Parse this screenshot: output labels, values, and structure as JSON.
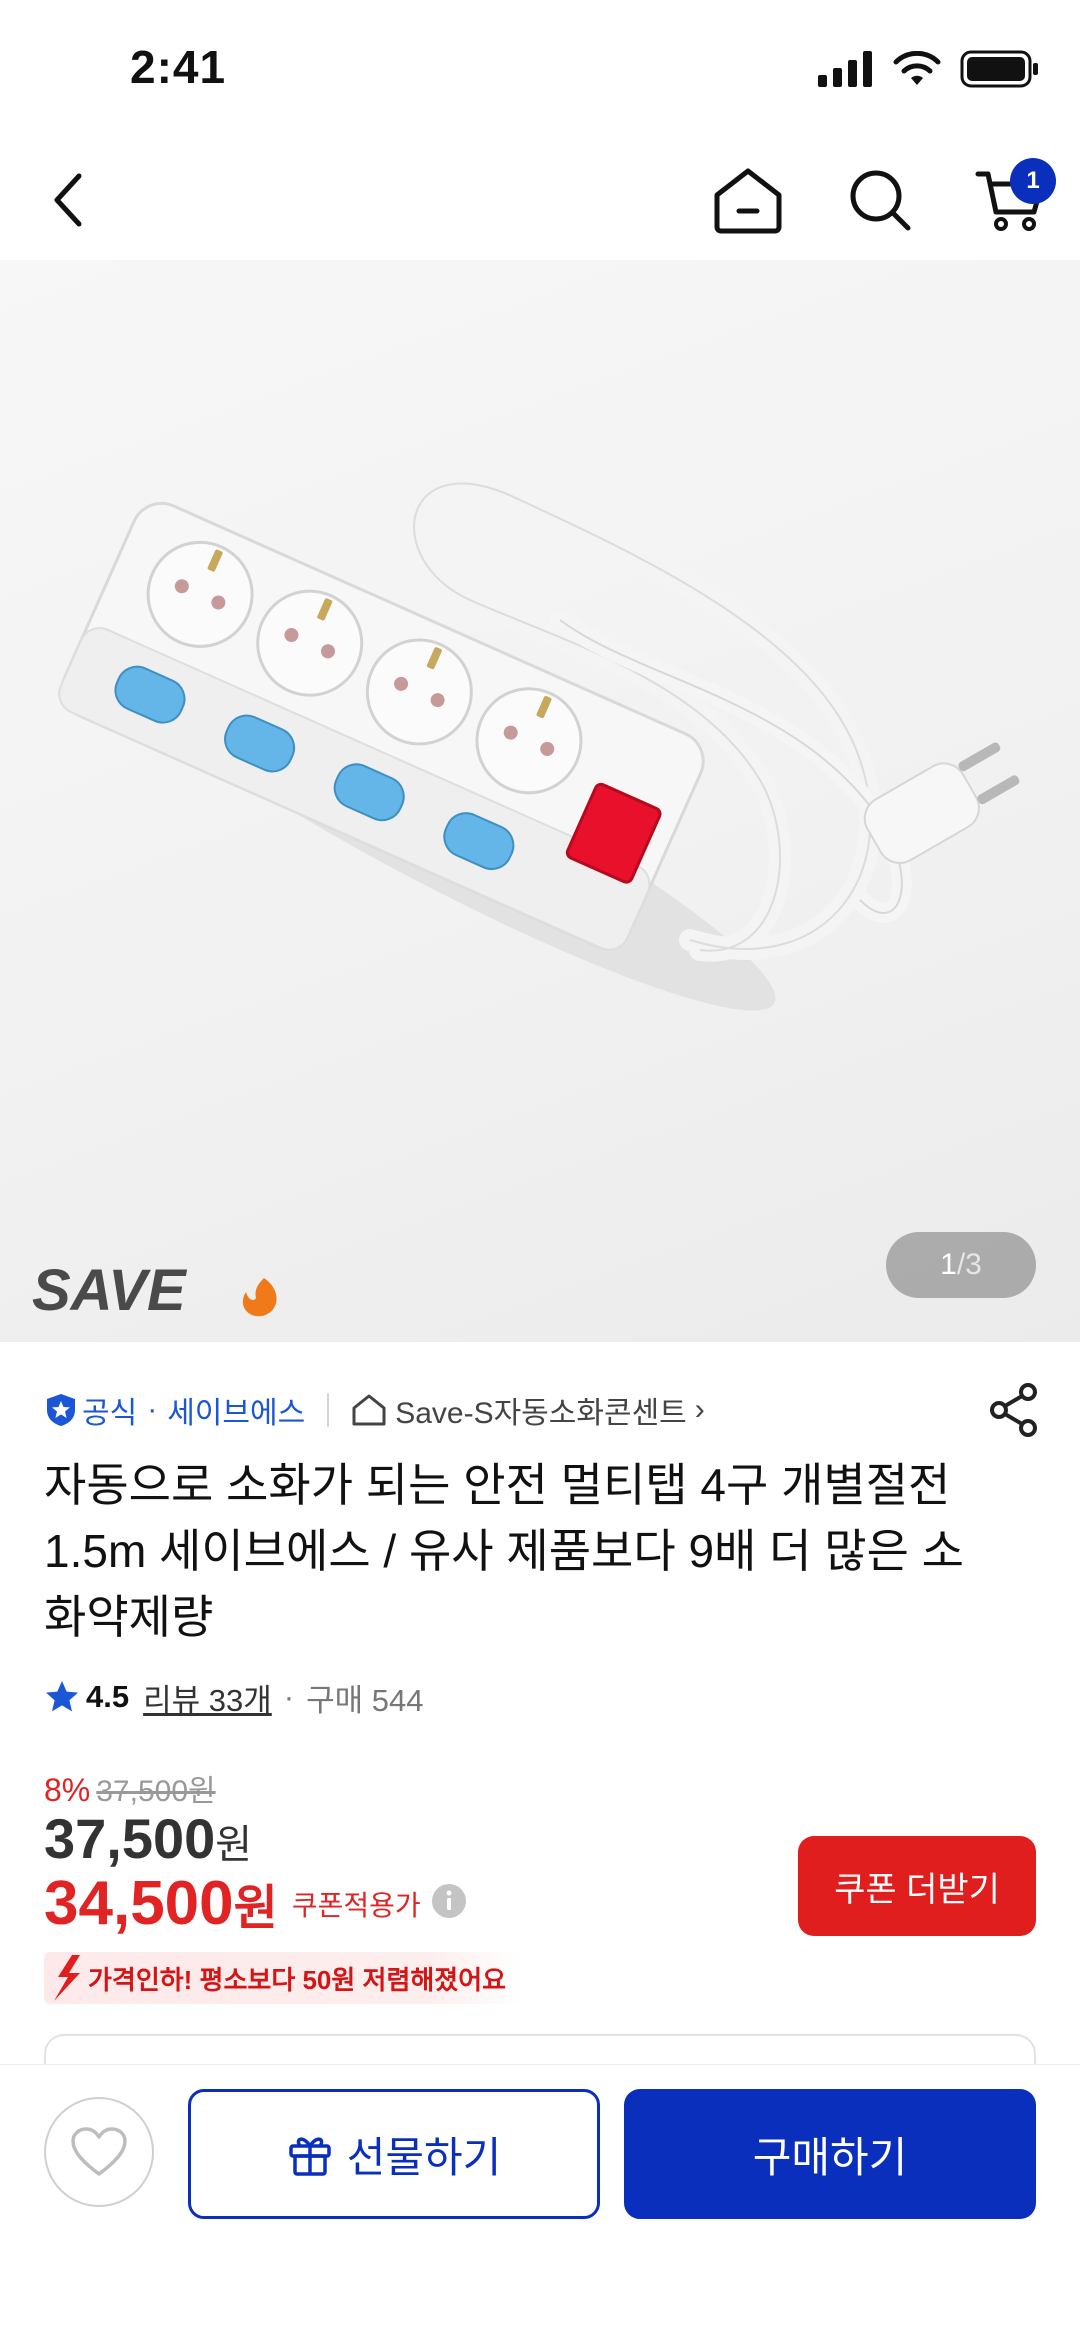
{
  "status_bar": {
    "time": "2:41"
  },
  "nav": {
    "cart_count": "1"
  },
  "gallery": {
    "brand_logo": "SAVE",
    "current": "1",
    "separator": "/",
    "total": "3"
  },
  "seller": {
    "official_label": "공식",
    "dot": "·",
    "name": "세이브에스",
    "store_name": "Save-S자동소화콘센트",
    "store_chevron": "›"
  },
  "product": {
    "title": "자동으로 소화가 되는 안전 멀티탭 4구 개별절전 1.5m 세이브에스 / 유사 제품보다 9배 더 많은 소화약제량"
  },
  "rating": {
    "score": "4.5",
    "reviews_label": "리뷰 33개",
    "dot": "·",
    "purchases_label": "구매 544"
  },
  "price": {
    "discount_rate": "8%",
    "original_price": "37,500원",
    "sale_price_value": "37,500",
    "sale_price_unit": "원",
    "coupon_price_value": "34,500",
    "coupon_price_unit": "원",
    "coupon_label": "쿠폰적용가",
    "coupon_button": "쿠폰 더받기",
    "price_drop_message": "가격인하! 평소보다 50원 저렴해졌어요"
  },
  "bottom_bar": {
    "gift_label": "선물하기",
    "buy_label": "구매하기"
  },
  "colors": {
    "brand_blue": "#0a2fbd",
    "sale_red": "#e02323",
    "link_blue": "#1a56d6"
  },
  "icons": [
    "back-icon",
    "home-icon",
    "search-icon",
    "cart-icon",
    "shield-check-icon",
    "store-home-icon",
    "share-icon",
    "star-icon",
    "info-icon",
    "down-arrow-icon",
    "heart-icon",
    "gift-icon"
  ]
}
